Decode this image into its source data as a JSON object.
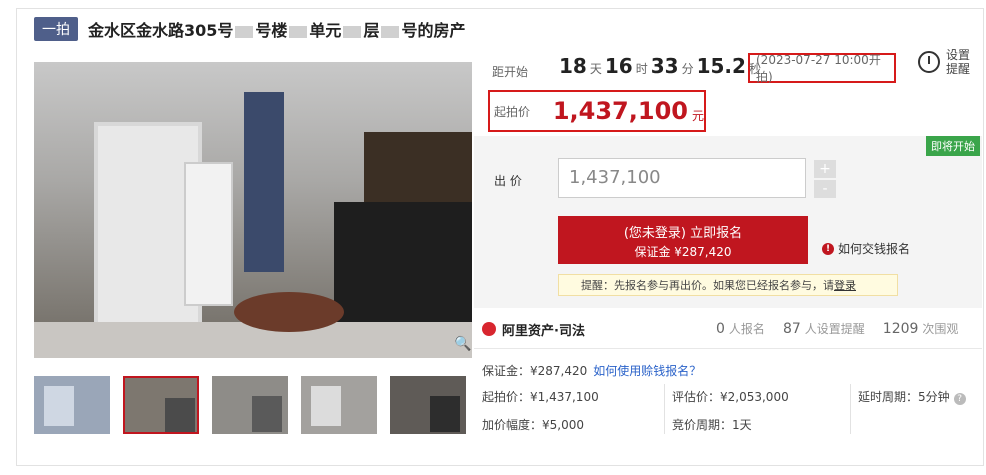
{
  "header": {
    "badge": "一拍",
    "title_parts": [
      "金水区金水路305号",
      "号楼",
      "单元",
      "层",
      "号的房产"
    ]
  },
  "countdown": {
    "label": "距开始",
    "days": "18",
    "days_unit": "天",
    "hours": "16",
    "hours_unit": "时",
    "minutes": "33",
    "minutes_unit": "分",
    "seconds": "15.2",
    "seconds_unit": "秒",
    "start_time": "(2023-07-27 10:00开拍)"
  },
  "remind": {
    "line1": "设置",
    "line2": "提醒"
  },
  "starting_price": {
    "label": "起拍价",
    "value": "1,437,100",
    "unit": "元"
  },
  "bid": {
    "status_badge": "即将开始",
    "label": "出 价",
    "input_value": "1,437,100",
    "plus": "+",
    "minus": "-",
    "signup_line1": "(您未登录) 立即报名",
    "signup_line2": "保证金 ¥287,420",
    "how_to": "如何交钱报名",
    "tip_prefix": "提醒：先报名参与再出价。如果您已经报名参与，请",
    "tip_link": "登录"
  },
  "platform": {
    "name": "阿里资产·司法"
  },
  "stats": {
    "signups": "0",
    "signups_label": "人报名",
    "reminders": "87",
    "reminders_label": "人设置提醒",
    "views": "1209",
    "views_label": "次围观"
  },
  "details": {
    "deposit": "保证金：¥287,420",
    "deposit_link": "如何使用赊钱报名？",
    "start_price": "起拍价：¥1,437,100",
    "appraisal": "评估价：¥2,053,000",
    "delay": "延时周期：5分钟",
    "increment": "加价幅度：¥5,000",
    "period": "竞价周期：1天"
  },
  "thumbnails": [
    "thumb-1",
    "thumb-2",
    "thumb-3",
    "thumb-4",
    "thumb-5"
  ],
  "colors": {
    "accent": "#c0161f",
    "badge": "#4f5f8a",
    "soon": "#3aa54a"
  }
}
